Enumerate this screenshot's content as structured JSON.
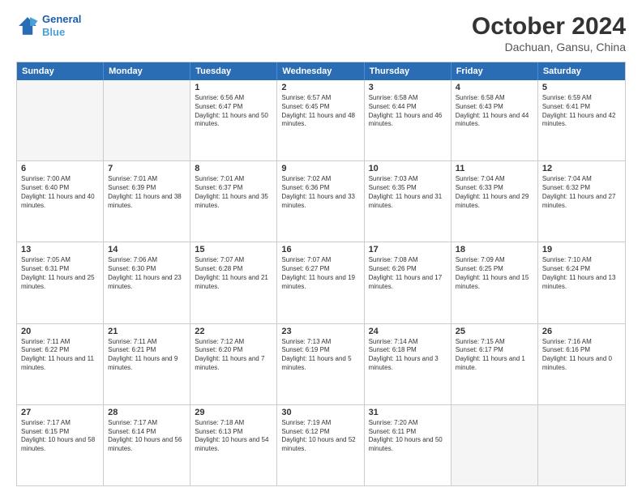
{
  "header": {
    "logo_line1": "General",
    "logo_line2": "Blue",
    "month": "October 2024",
    "location": "Dachuan, Gansu, China"
  },
  "weekdays": [
    "Sunday",
    "Monday",
    "Tuesday",
    "Wednesday",
    "Thursday",
    "Friday",
    "Saturday"
  ],
  "rows": [
    [
      {
        "day": "",
        "text": ""
      },
      {
        "day": "",
        "text": ""
      },
      {
        "day": "1",
        "text": "Sunrise: 6:56 AM\nSunset: 6:47 PM\nDaylight: 11 hours and 50 minutes."
      },
      {
        "day": "2",
        "text": "Sunrise: 6:57 AM\nSunset: 6:45 PM\nDaylight: 11 hours and 48 minutes."
      },
      {
        "day": "3",
        "text": "Sunrise: 6:58 AM\nSunset: 6:44 PM\nDaylight: 11 hours and 46 minutes."
      },
      {
        "day": "4",
        "text": "Sunrise: 6:58 AM\nSunset: 6:43 PM\nDaylight: 11 hours and 44 minutes."
      },
      {
        "day": "5",
        "text": "Sunrise: 6:59 AM\nSunset: 6:41 PM\nDaylight: 11 hours and 42 minutes."
      }
    ],
    [
      {
        "day": "6",
        "text": "Sunrise: 7:00 AM\nSunset: 6:40 PM\nDaylight: 11 hours and 40 minutes."
      },
      {
        "day": "7",
        "text": "Sunrise: 7:01 AM\nSunset: 6:39 PM\nDaylight: 11 hours and 38 minutes."
      },
      {
        "day": "8",
        "text": "Sunrise: 7:01 AM\nSunset: 6:37 PM\nDaylight: 11 hours and 35 minutes."
      },
      {
        "day": "9",
        "text": "Sunrise: 7:02 AM\nSunset: 6:36 PM\nDaylight: 11 hours and 33 minutes."
      },
      {
        "day": "10",
        "text": "Sunrise: 7:03 AM\nSunset: 6:35 PM\nDaylight: 11 hours and 31 minutes."
      },
      {
        "day": "11",
        "text": "Sunrise: 7:04 AM\nSunset: 6:33 PM\nDaylight: 11 hours and 29 minutes."
      },
      {
        "day": "12",
        "text": "Sunrise: 7:04 AM\nSunset: 6:32 PM\nDaylight: 11 hours and 27 minutes."
      }
    ],
    [
      {
        "day": "13",
        "text": "Sunrise: 7:05 AM\nSunset: 6:31 PM\nDaylight: 11 hours and 25 minutes."
      },
      {
        "day": "14",
        "text": "Sunrise: 7:06 AM\nSunset: 6:30 PM\nDaylight: 11 hours and 23 minutes."
      },
      {
        "day": "15",
        "text": "Sunrise: 7:07 AM\nSunset: 6:28 PM\nDaylight: 11 hours and 21 minutes."
      },
      {
        "day": "16",
        "text": "Sunrise: 7:07 AM\nSunset: 6:27 PM\nDaylight: 11 hours and 19 minutes."
      },
      {
        "day": "17",
        "text": "Sunrise: 7:08 AM\nSunset: 6:26 PM\nDaylight: 11 hours and 17 minutes."
      },
      {
        "day": "18",
        "text": "Sunrise: 7:09 AM\nSunset: 6:25 PM\nDaylight: 11 hours and 15 minutes."
      },
      {
        "day": "19",
        "text": "Sunrise: 7:10 AM\nSunset: 6:24 PM\nDaylight: 11 hours and 13 minutes."
      }
    ],
    [
      {
        "day": "20",
        "text": "Sunrise: 7:11 AM\nSunset: 6:22 PM\nDaylight: 11 hours and 11 minutes."
      },
      {
        "day": "21",
        "text": "Sunrise: 7:11 AM\nSunset: 6:21 PM\nDaylight: 11 hours and 9 minutes."
      },
      {
        "day": "22",
        "text": "Sunrise: 7:12 AM\nSunset: 6:20 PM\nDaylight: 11 hours and 7 minutes."
      },
      {
        "day": "23",
        "text": "Sunrise: 7:13 AM\nSunset: 6:19 PM\nDaylight: 11 hours and 5 minutes."
      },
      {
        "day": "24",
        "text": "Sunrise: 7:14 AM\nSunset: 6:18 PM\nDaylight: 11 hours and 3 minutes."
      },
      {
        "day": "25",
        "text": "Sunrise: 7:15 AM\nSunset: 6:17 PM\nDaylight: 11 hours and 1 minute."
      },
      {
        "day": "26",
        "text": "Sunrise: 7:16 AM\nSunset: 6:16 PM\nDaylight: 11 hours and 0 minutes."
      }
    ],
    [
      {
        "day": "27",
        "text": "Sunrise: 7:17 AM\nSunset: 6:15 PM\nDaylight: 10 hours and 58 minutes."
      },
      {
        "day": "28",
        "text": "Sunrise: 7:17 AM\nSunset: 6:14 PM\nDaylight: 10 hours and 56 minutes."
      },
      {
        "day": "29",
        "text": "Sunrise: 7:18 AM\nSunset: 6:13 PM\nDaylight: 10 hours and 54 minutes."
      },
      {
        "day": "30",
        "text": "Sunrise: 7:19 AM\nSunset: 6:12 PM\nDaylight: 10 hours and 52 minutes."
      },
      {
        "day": "31",
        "text": "Sunrise: 7:20 AM\nSunset: 6:11 PM\nDaylight: 10 hours and 50 minutes."
      },
      {
        "day": "",
        "text": ""
      },
      {
        "day": "",
        "text": ""
      }
    ]
  ]
}
